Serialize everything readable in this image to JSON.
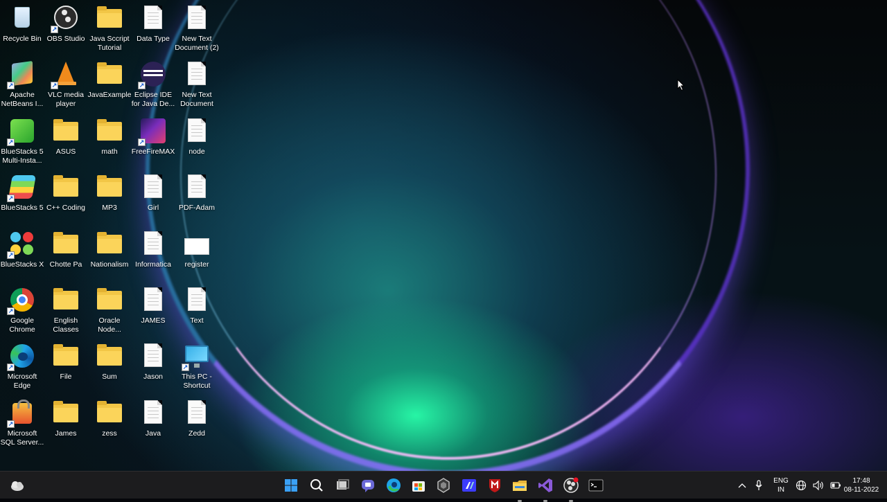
{
  "desktop": {
    "icons": [
      {
        "label": "Recycle Bin",
        "type": "recycle-bin"
      },
      {
        "label": "OBS Studio",
        "type": "obs"
      },
      {
        "label": "Java Sccript Tutorial",
        "type": "folder"
      },
      {
        "label": "Data Type",
        "type": "text-document"
      },
      {
        "label": "New Text Document (2)",
        "type": "text-document"
      },
      {
        "label": "Apache NetBeans I...",
        "type": "netbeans"
      },
      {
        "label": "VLC media player",
        "type": "vlc"
      },
      {
        "label": "JavaExample",
        "type": "folder"
      },
      {
        "label": "Eclipse IDE for Java De...",
        "type": "eclipse"
      },
      {
        "label": "New Text Document",
        "type": "text-document"
      },
      {
        "label": "BlueStacks 5 Multi-Insta...",
        "type": "bluestacks-multi"
      },
      {
        "label": "ASUS",
        "type": "folder"
      },
      {
        "label": "math",
        "type": "folder"
      },
      {
        "label": "FreeFireMAX",
        "type": "freefire"
      },
      {
        "label": "node",
        "type": "text-document"
      },
      {
        "label": "BlueStacks 5",
        "type": "bluestacks"
      },
      {
        "label": "C++ Coding",
        "type": "folder"
      },
      {
        "label": "MP3",
        "type": "folder"
      },
      {
        "label": "Girl",
        "type": "text-document"
      },
      {
        "label": "PDF-Adam",
        "type": "text-document"
      },
      {
        "label": "BlueStacks X",
        "type": "bluestacks-x"
      },
      {
        "label": "Chotte Pa",
        "type": "folder"
      },
      {
        "label": "Nationalism",
        "type": "folder"
      },
      {
        "label": "Informatica",
        "type": "text-document"
      },
      {
        "label": "register",
        "type": "file"
      },
      {
        "label": "Google Chrome",
        "type": "chrome"
      },
      {
        "label": "English Classes",
        "type": "folder"
      },
      {
        "label": "Oracle Node...",
        "type": "folder"
      },
      {
        "label": "JAMES",
        "type": "text-document"
      },
      {
        "label": "Text",
        "type": "text-document"
      },
      {
        "label": "Microsoft Edge",
        "type": "edge"
      },
      {
        "label": "File",
        "type": "folder"
      },
      {
        "label": "Sum",
        "type": "folder"
      },
      {
        "label": "Jason",
        "type": "text-document"
      },
      {
        "label": "This PC - Shortcut",
        "type": "this-pc"
      },
      {
        "label": "Microsoft SQL Server...",
        "type": "sql-server"
      },
      {
        "label": "James",
        "type": "folder"
      },
      {
        "label": "zess",
        "type": "folder"
      },
      {
        "label": "Java",
        "type": "text-document"
      },
      {
        "label": "Zedd",
        "type": "text-document"
      }
    ]
  },
  "taskbar": {
    "apps": [
      {
        "name": "start-icon"
      },
      {
        "name": "search-icon"
      },
      {
        "name": "task-view-icon"
      },
      {
        "name": "teams-chat-icon"
      },
      {
        "name": "edge-icon"
      },
      {
        "name": "store-icon"
      },
      {
        "name": "app-icon"
      },
      {
        "name": "app-icon"
      },
      {
        "name": "mcafee-icon"
      },
      {
        "name": "file-explorer-icon"
      },
      {
        "name": "visual-studio-icon"
      },
      {
        "name": "obs-icon"
      },
      {
        "name": "terminal-icon"
      }
    ],
    "language_line1": "ENG",
    "language_line2": "IN",
    "time": "17:48",
    "date": "08-11-2022"
  },
  "colors": {
    "taskbar_bg": "#1c1c1e",
    "folder_yellow": "#fbd45a",
    "accent_blue": "#0078d4"
  }
}
